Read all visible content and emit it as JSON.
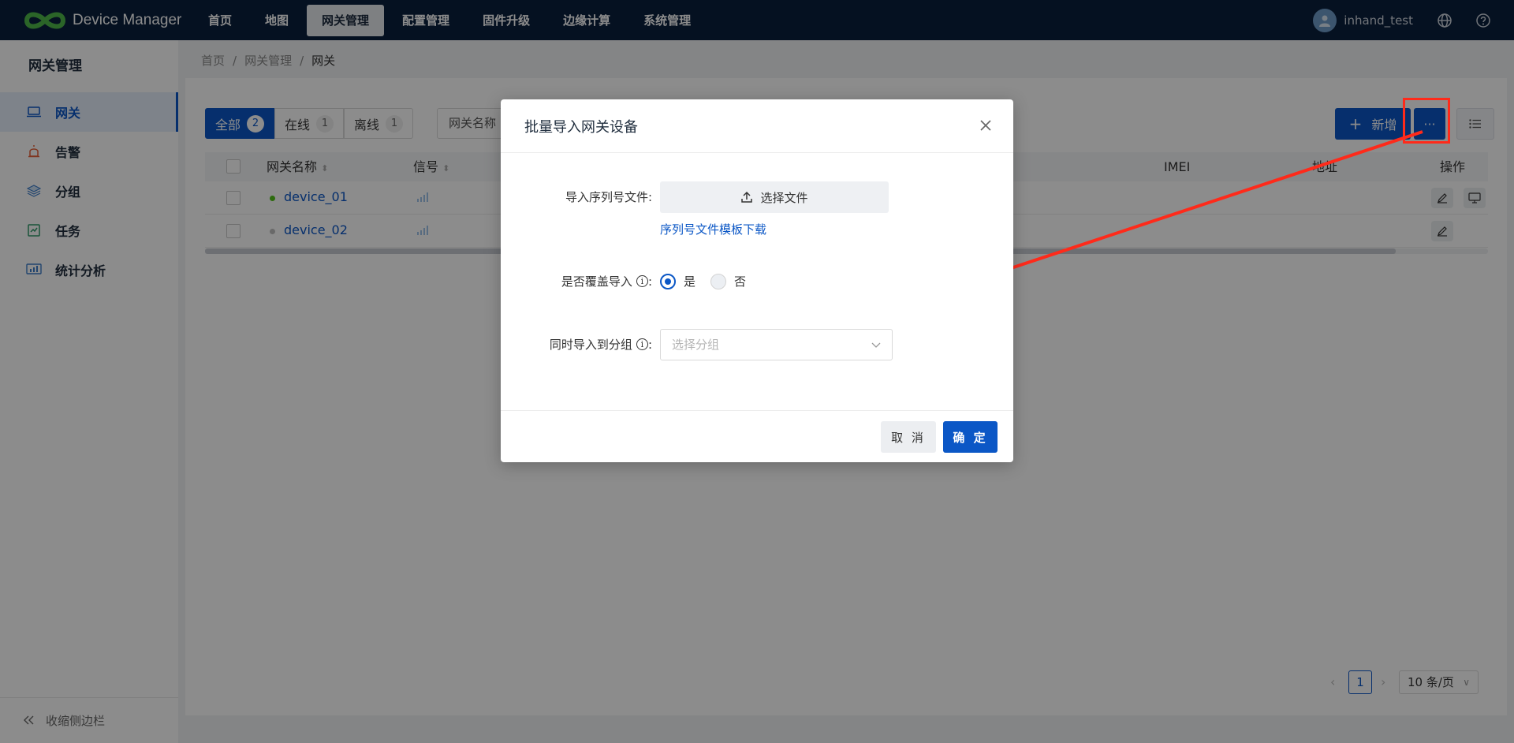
{
  "app": {
    "name": "Device Manager"
  },
  "nav": [
    "首页",
    "地图",
    "网关管理",
    "配置管理",
    "固件升级",
    "边缘计算",
    "系统管理"
  ],
  "nav_active": "网关管理",
  "user": {
    "name": "inhand_test"
  },
  "sidebar": {
    "title": "网关管理",
    "items": [
      {
        "label": "网关",
        "icon": "laptop-icon"
      },
      {
        "label": "告警",
        "icon": "alarm-icon"
      },
      {
        "label": "分组",
        "icon": "layers-icon"
      },
      {
        "label": "任务",
        "icon": "task-icon"
      },
      {
        "label": "统计分析",
        "icon": "chart-icon"
      }
    ],
    "collapse_label": "收缩侧边栏"
  },
  "breadcrumb": [
    "首页",
    "网关管理",
    "网关"
  ],
  "tabs": [
    {
      "label": "全部",
      "count": "2"
    },
    {
      "label": "在线",
      "count": "1"
    },
    {
      "label": "离线",
      "count": "1"
    }
  ],
  "filter": {
    "label": "网关名称"
  },
  "toolbar": {
    "add_label": "新增",
    "more_label": "···"
  },
  "table": {
    "columns": [
      "网关名称",
      "信号",
      "IMEI",
      "地址",
      "操作"
    ],
    "rows": [
      {
        "name": "device_01",
        "status": "online"
      },
      {
        "name": "device_02",
        "status": "offline"
      }
    ]
  },
  "pagination": {
    "current": "1",
    "page_size": "10 条/页"
  },
  "modal": {
    "title": "批量导入网关设备",
    "file_label": "导入序列号文件:",
    "file_button": "选择文件",
    "template_link": "序列号文件模板下载",
    "overwrite_label": "是否覆盖导入",
    "overwrite_options": [
      "是",
      "否"
    ],
    "overwrite_selected": "是",
    "group_label": "同时导入到分组",
    "group_placeholder": "选择分组",
    "colon": ":",
    "info_glyph": "i",
    "cancel": "取 消",
    "ok": "确 定"
  },
  "colors": {
    "primary": "#0b57c6",
    "topbar": "#0a1f3c",
    "annotation": "#ff2a1a",
    "online": "#52c41a",
    "offline": "#c0c0c0"
  }
}
